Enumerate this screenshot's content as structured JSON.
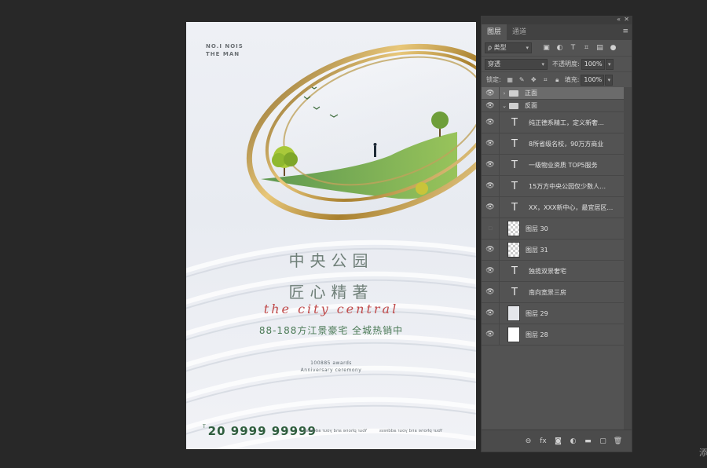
{
  "poster": {
    "mirror_text_1": "NO.I NOIS",
    "mirror_text_2": "THE MAN",
    "title_1": "中央公园",
    "title_2": "匠心精著",
    "script_text": "the city central",
    "subline": "88-188方江景豪宅  全城热销中",
    "awards_1": "100885 awards",
    "awards_2": "Anniversary ceremony",
    "phone": "20 9999 99999",
    "phone_prefix": "T",
    "address_1": "Your phone and your address",
    "address_2": "Your phone and your address"
  },
  "panel": {
    "collapse_icon": "double-chevron-icon",
    "close_icon": "close-icon",
    "tabs": [
      {
        "label": "图层",
        "active": true
      },
      {
        "label": "通道",
        "active": false
      }
    ],
    "filter_label": "ρ 类型",
    "blend_mode": "穿透",
    "opacity_label": "不透明度:",
    "opacity_value": "100%",
    "lock_label": "锁定:",
    "fill_label": "填充:",
    "fill_value": "100%",
    "layers": [
      {
        "name": "正面",
        "type": "group",
        "visible": true,
        "expanded": false,
        "selected": true
      },
      {
        "name": "反面",
        "type": "group",
        "visible": true,
        "expanded": true,
        "selected": false
      },
      {
        "name": "纯正德系精工，定义新奢…",
        "type": "text",
        "visible": true
      },
      {
        "name": "8所省级名校，90万方商业",
        "type": "text",
        "visible": true
      },
      {
        "name": "一级物业资质 TOP5服务",
        "type": "text",
        "visible": true
      },
      {
        "name": "15万方中央公园仅少数人…",
        "type": "text",
        "visible": true
      },
      {
        "name": "XX，XXX新中心，最宜居区…",
        "type": "text",
        "visible": true
      },
      {
        "name": "图层 30",
        "type": "pixel",
        "visible": false
      },
      {
        "name": "图层 31",
        "type": "pixel",
        "visible": true
      },
      {
        "name": "独揽双景奢宅",
        "type": "text",
        "visible": true
      },
      {
        "name": "南向宽景三房",
        "type": "text",
        "visible": true
      },
      {
        "name": "图层 29",
        "type": "image",
        "visible": true
      },
      {
        "name": "图层 28",
        "type": "white",
        "visible": true
      }
    ]
  },
  "corner_char": "添"
}
